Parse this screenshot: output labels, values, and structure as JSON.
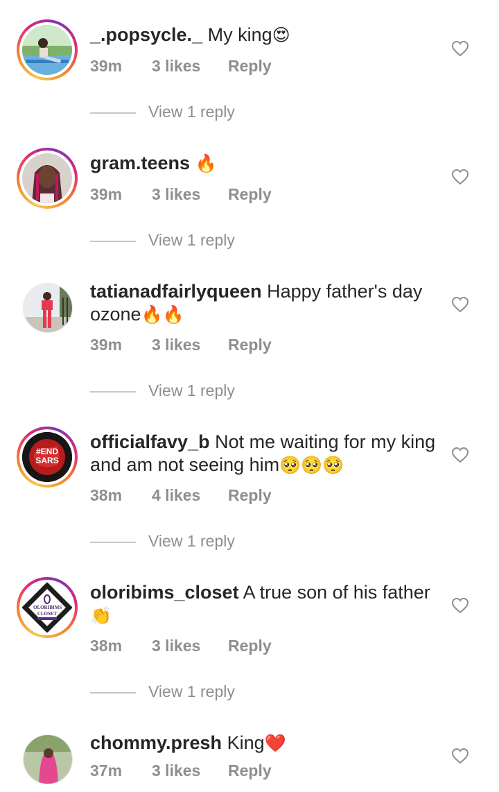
{
  "comments": [
    {
      "username": "_.popsycle._",
      "text": "My king",
      "emoji": "😍",
      "time": "39m",
      "likes": "3 likes",
      "reply_label": "Reply",
      "view_replies": "View 1 reply",
      "avatar": "photo-person-outdoors"
    },
    {
      "username": "gram.teens",
      "text": "",
      "emoji": "🔥",
      "time": "39m",
      "likes": "3 likes",
      "reply_label": "Reply",
      "view_replies": "View 1 reply",
      "avatar": "photo-girl-braids"
    },
    {
      "username": "tatianadfairlyqueen",
      "text": "Happy father's day ozone",
      "emoji": "🔥🔥",
      "time": "39m",
      "likes": "3 likes",
      "reply_label": "Reply",
      "view_replies": "View 1 reply",
      "avatar": "photo-woman-red-outfit"
    },
    {
      "username": "officialfavy_b",
      "text": "Not me waiting for my king and am not seeing him",
      "emoji": "🥺🥺🥺",
      "time": "38m",
      "likes": "4 likes",
      "reply_label": "Reply",
      "view_replies": "View 1 reply",
      "avatar": "endsars-logo",
      "avatar_text": "#END SARS"
    },
    {
      "username": "oloribims_closet",
      "text": "A true son of his father",
      "emoji": "👏",
      "time": "38m",
      "likes": "3 likes",
      "reply_label": "Reply",
      "view_replies": "View 1 reply",
      "avatar": "oloribims-closet-logo",
      "avatar_text": "OLORIBIMS CLOSET"
    },
    {
      "username": "chommy.presh",
      "text": "King",
      "emoji": "❤️",
      "time": "37m",
      "likes": "3 likes",
      "reply_label": "Reply",
      "avatar": "photo-woman-pink-hair"
    }
  ],
  "colors": {
    "text": "#262626",
    "secondary": "#8e8e8e",
    "heart_outline": "#8e8e8e",
    "story_ring": [
      "#f9c74f",
      "#f58529",
      "#dd2a7b",
      "#8134af"
    ]
  },
  "icons": {
    "like": "heart-outline-icon"
  }
}
